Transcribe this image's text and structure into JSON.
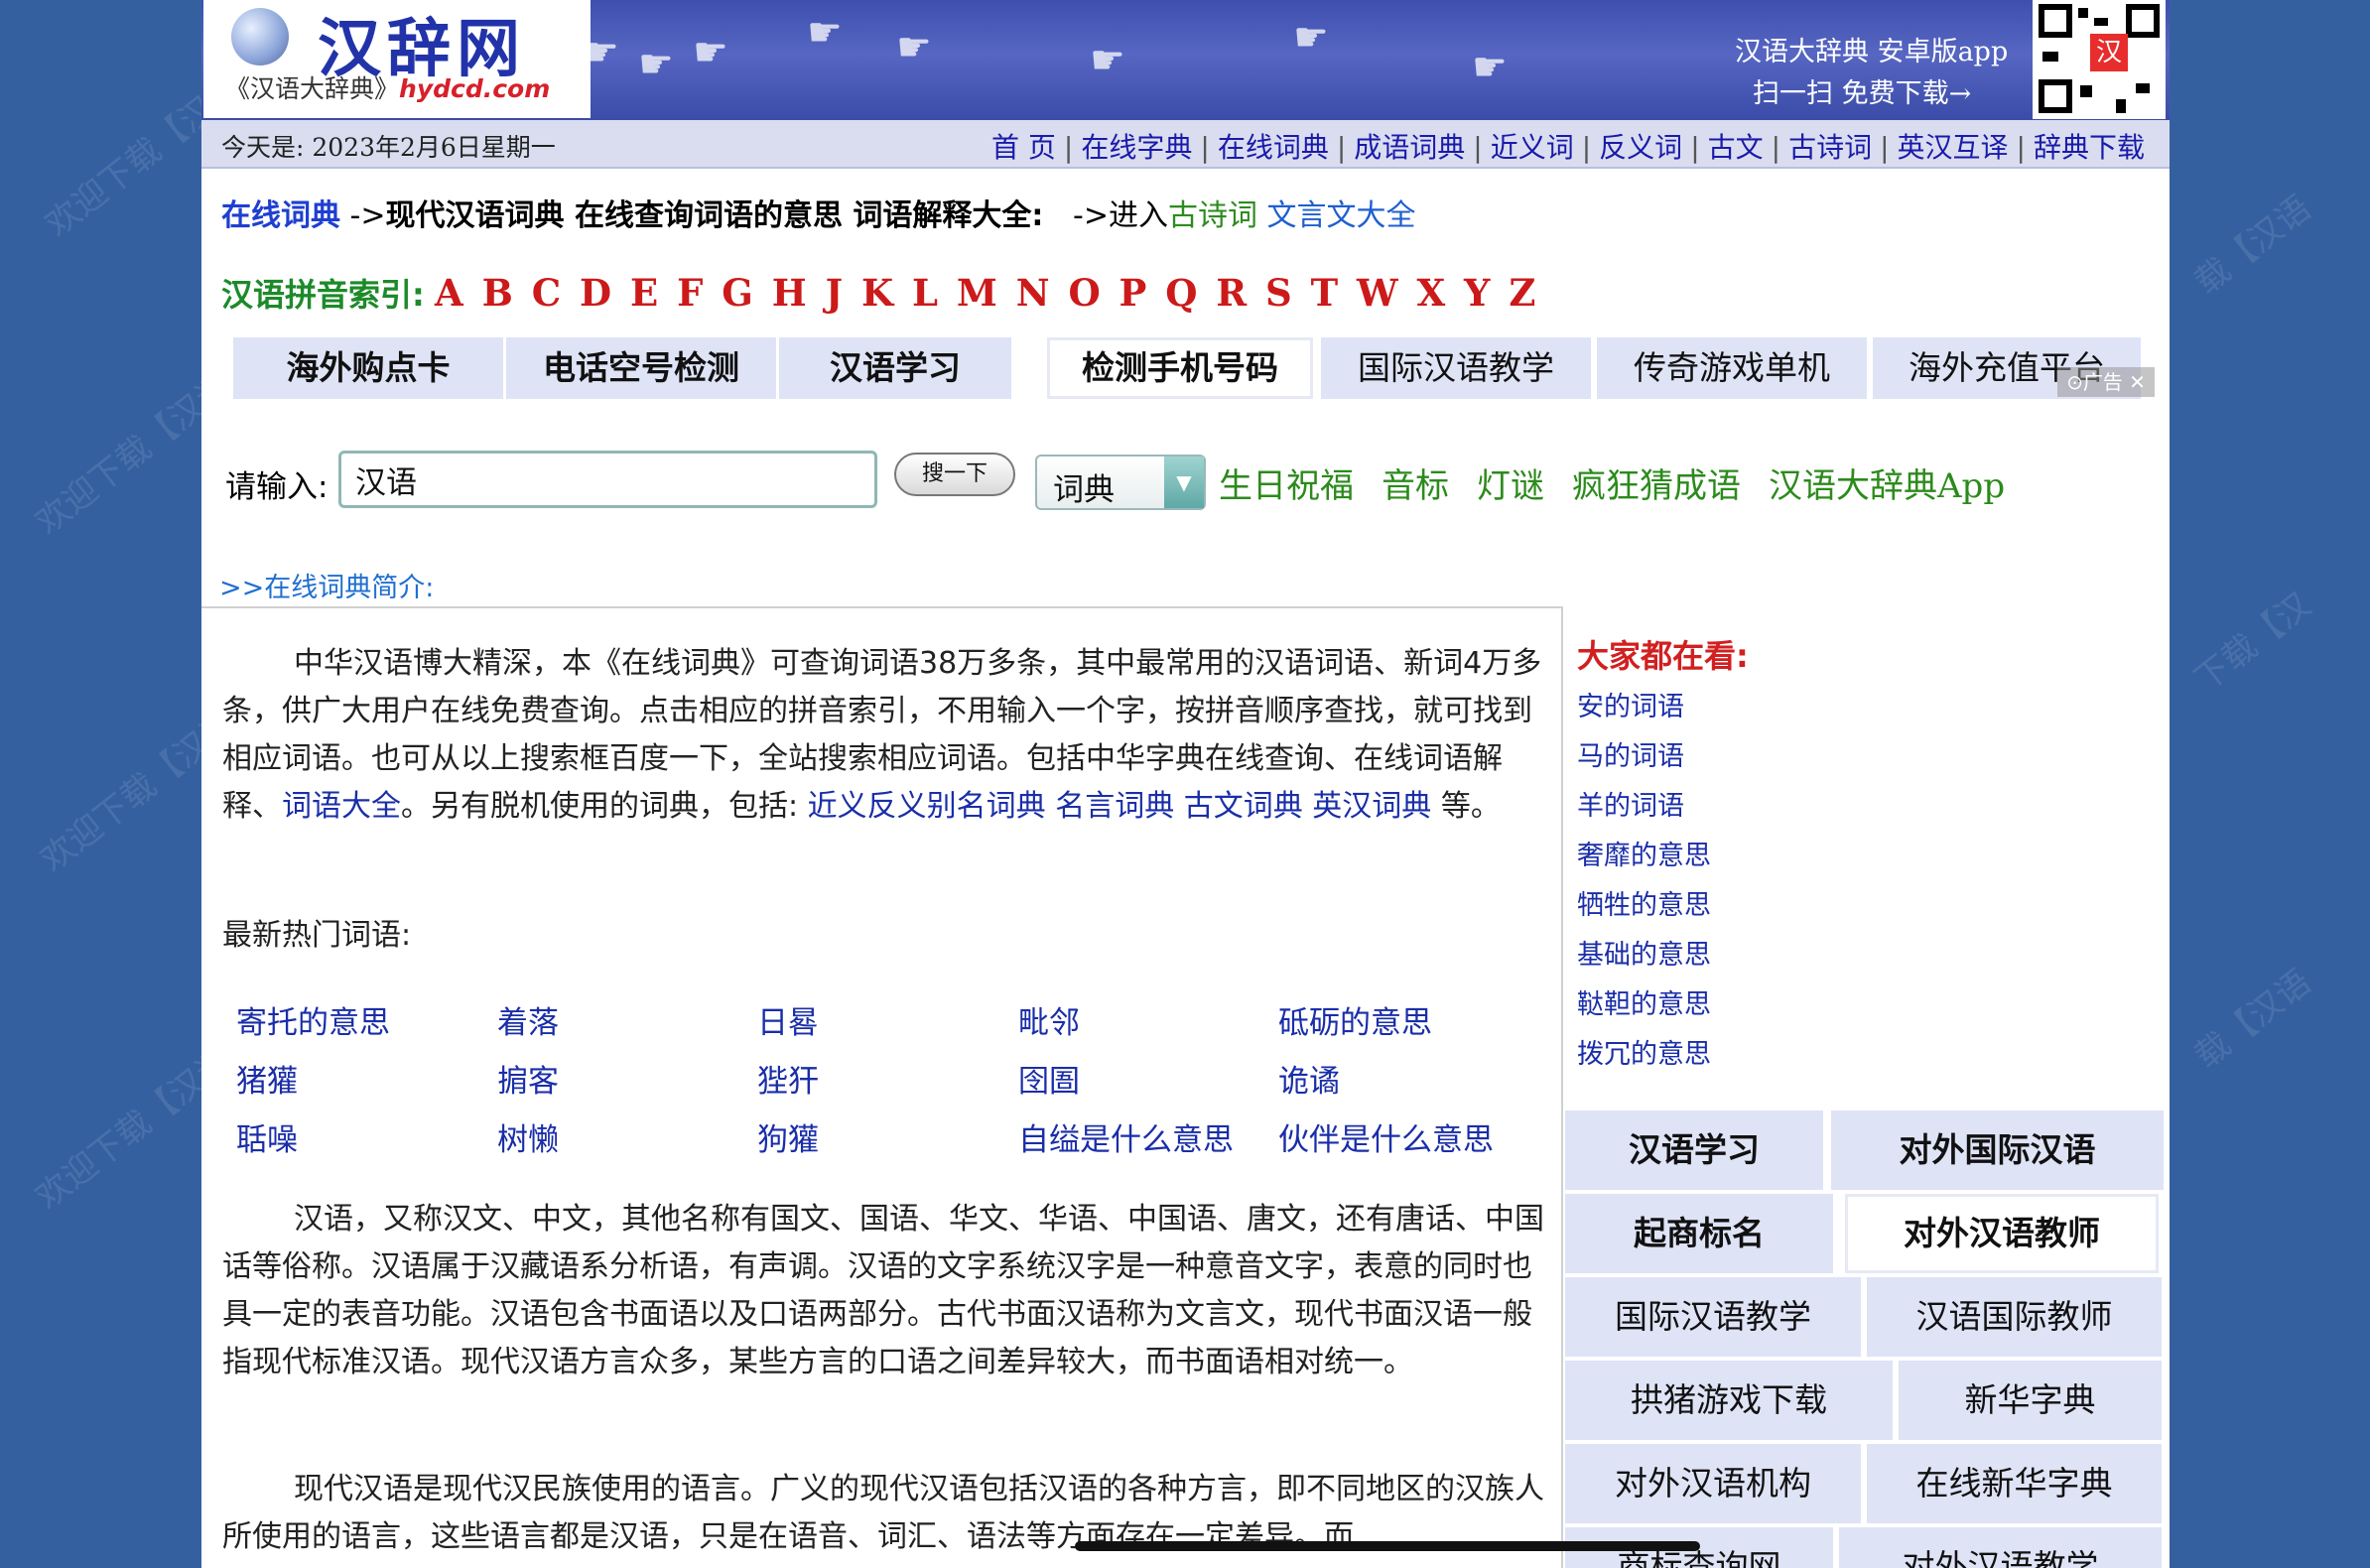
{
  "header": {
    "logo_text": "汉辞网",
    "logo_sub": "《汉语大辞典》",
    "logo_url": "hydcd.com",
    "app_line1": "汉语大辞典 安卓版app",
    "app_line2": "扫一扫 免费下载→",
    "qr_mark": "汉"
  },
  "navbar": {
    "today": "今天是: 2023年2月6日星期一",
    "links": [
      "首 页",
      "在线字典",
      "在线词典",
      "成语词典",
      "近义词",
      "反义词",
      "古文",
      "古诗词",
      "英汉互译",
      "辞典下载"
    ]
  },
  "breadcrumb": {
    "link": "在线词典",
    "arrow": " ->",
    "title": "现代汉语词典 在线查询词语的意思 词语解释大全:",
    "enter": "->进入",
    "enter_green": "古诗词",
    "enter_blue": "文言文大全"
  },
  "pinyin": {
    "label": "汉语拼音索引:",
    "letters": "A B C D E F G H J K L M N O P Q R S T W X Y Z"
  },
  "ad_tabs": [
    "海外购点卡",
    "电话空号检测",
    "汉语学习",
    "检测手机号码",
    "国际汉语教学",
    "传奇游戏单机",
    "海外充值平台"
  ],
  "ad_badge": "⊙广告 ✕",
  "search": {
    "label": "请输入:",
    "value": "汉语",
    "button": "搜一下",
    "select_value": "词典",
    "quick_links": [
      "生日祝福",
      "音标",
      "灯谜",
      "疯狂猜成语",
      "汉语大辞典App"
    ]
  },
  "intro_link": ">>在线词典简介:",
  "intro": {
    "text1": "中华汉语博大精深，本《在线词典》可查询词语38万多条，其中最常用的汉语词语、新词4万多条，供广大用户在线免费查询。点击相应的拼音索引，不用输入一个字，按拼音顺序查找，就可找到相应词语。也可从以上搜索框百度一下，全站搜索相应词语。包括中华字典在线查询、在线词语解释、",
    "link1": "词语大全",
    "text2": "。另有脱机使用的词典，包括: ",
    "link2": "近义反义别名词典",
    "link3": "名言词典",
    "link4": "古文词典",
    "link5": "英汉词典",
    "text3": " 等。"
  },
  "hot": {
    "title": "最新热门词语:",
    "words": [
      "寄托的意思",
      "着落",
      "日晷",
      "毗邻",
      "砥砺的意思",
      "猪獾",
      "掮客",
      "狴犴",
      "囹圄",
      "诡谲",
      "聒噪",
      "树懒",
      "狗獾",
      "自缢是什么意思",
      "伙伴是什么意思"
    ]
  },
  "para2": "汉语，又称汉文、中文，其他名称有国文、国语、华文、华语、中国语、唐文，还有唐话、中国话等俗称。汉语属于汉藏语系分析语，有声调。汉语的文字系统汉字是一种意音文字，表意的同时也具一定的表音功能。汉语包含书面语以及口语两部分。古代书面汉语称为文言文，现代书面汉语一般指现代标准汉语。现代汉语方言众多，某些方言的口语之间差异较大，而书面语相对统一。",
  "para3": "现代汉语是现代汉民族使用的语言。广义的现代汉语包括汉语的各种方言，即不同地区的汉族人所使用的语言，这些语言都是汉语，只是在语音、词汇、语法等方面存在一定差异。而",
  "sidebar": {
    "title": "大家都在看:",
    "links": [
      "安的词语",
      "马的词语",
      "羊的词语",
      "奢靡的意思",
      "牺牲的意思",
      "基础的意思",
      "鞑靼的意思",
      "拨冗的意思"
    ],
    "buttons": [
      "汉语学习",
      "对外国际汉语",
      "起商标名",
      "对外汉语教师",
      "国际汉语教学",
      "汉语国际教师",
      "拱猪游戏下载",
      "新华字典",
      "对外汉语机构",
      "在线新华字典",
      "商标查询网",
      "对外汉语教学"
    ]
  }
}
